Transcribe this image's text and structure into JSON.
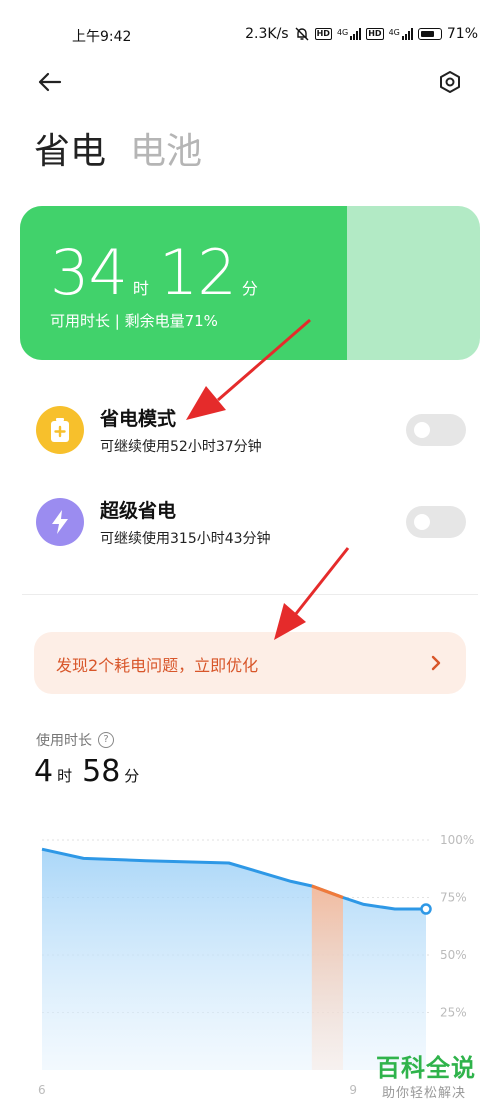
{
  "status_bar": {
    "time": "上午9:42",
    "speed": "2.3K/s",
    "battery_percent": "71%",
    "network_labels": [
      "HD",
      "4G",
      "HD",
      "4G"
    ]
  },
  "header": {
    "back_icon": "back-arrow-icon",
    "settings_icon": "settings-hexagon-icon",
    "tabs": [
      {
        "label": "省电",
        "active": true
      },
      {
        "label": "电池",
        "active": false
      }
    ]
  },
  "battery_card": {
    "hours": "34",
    "hours_unit": "时",
    "minutes": "12",
    "minutes_unit": "分",
    "subtitle": "可用时长 | 剩余电量71%",
    "level": 0.71,
    "fill_color": "#41d26b",
    "track_color": "#b2eac5"
  },
  "modes": [
    {
      "title": "省电模式",
      "desc": "可继续使用52小时37分钟",
      "icon": "battery-plus-icon",
      "icon_color": "#f7c02c",
      "enabled": false
    },
    {
      "title": "超级省电",
      "desc": "可继续使用315小时43分钟",
      "icon": "lightning-icon",
      "icon_color": "#9b8cf0",
      "enabled": false
    }
  ],
  "optimize_banner": {
    "text": "发现2个耗电问题，立即优化",
    "color": "#d8562a"
  },
  "usage": {
    "label": "使用时长",
    "hours": "4",
    "hours_unit": "时",
    "minutes": "58",
    "minutes_unit": "分"
  },
  "chart_data": {
    "type": "area",
    "x": [
      6,
      6.4,
      7,
      7.8,
      8.4,
      8.6,
      8.9,
      9.1,
      9.4,
      9.7
    ],
    "y": [
      96,
      92,
      91,
      90,
      82,
      80,
      75,
      72,
      70,
      70
    ],
    "ylim": [
      0,
      100
    ],
    "y_ticks": [
      "100%",
      "75%",
      "50%",
      "25%"
    ],
    "x_ticks": [
      "6",
      "9"
    ],
    "highlight_range": [
      8.6,
      8.9
    ],
    "line_color": "#2e98e6",
    "highlight_color": "#f07a3a",
    "grid": true
  },
  "watermark": {
    "title": "百科全说",
    "subtitle": "助你轻松解决"
  }
}
